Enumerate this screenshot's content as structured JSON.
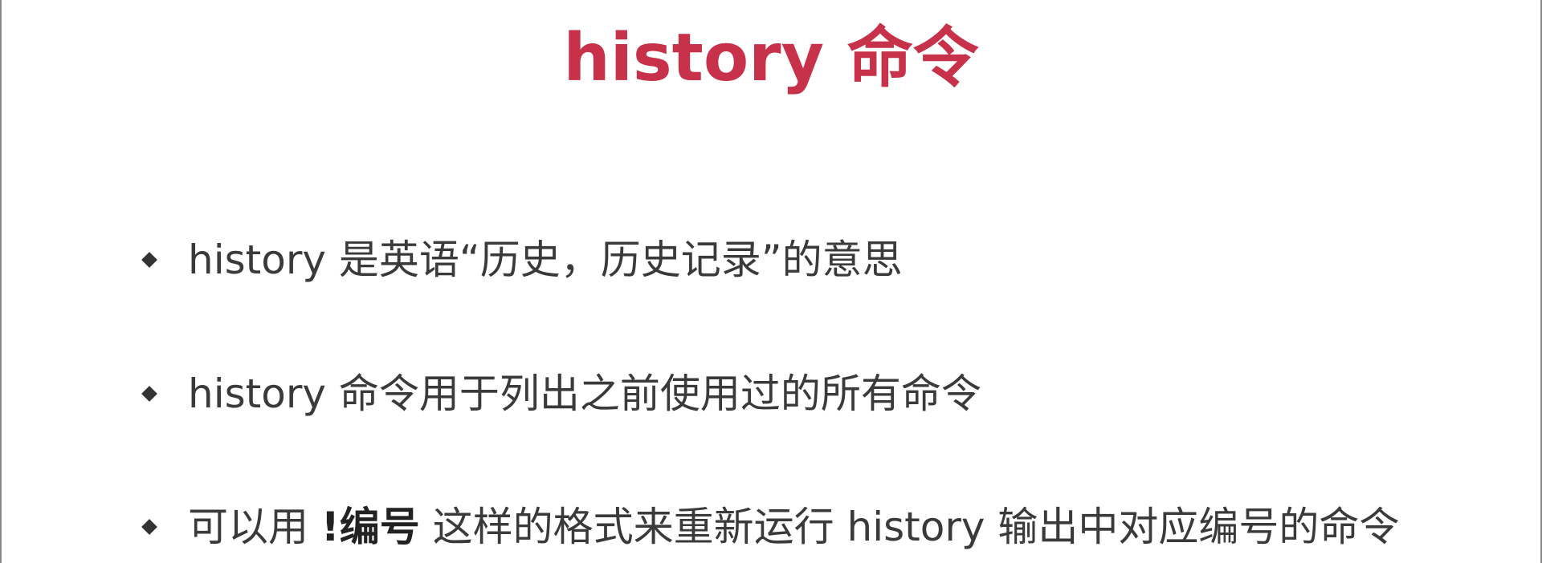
{
  "slide": {
    "title": "history 命令",
    "bullets": [
      {
        "text": "history 是英语“历史，历史记录”的意思"
      },
      {
        "text": "history 命令用于列出之前使用过的所有命令"
      },
      {
        "text_before": "可以用 ",
        "text_bold": "!编号",
        "text_after": " 这样的格式来重新运行 history 输出中对应编号的命令"
      }
    ]
  },
  "colors": {
    "title": "#c7324a",
    "body_text": "#3a3a3a",
    "bullet_marker": "#333333",
    "background": "#ffffff"
  },
  "icons": {
    "bullet_marker": "diamond-bullet-icon"
  }
}
